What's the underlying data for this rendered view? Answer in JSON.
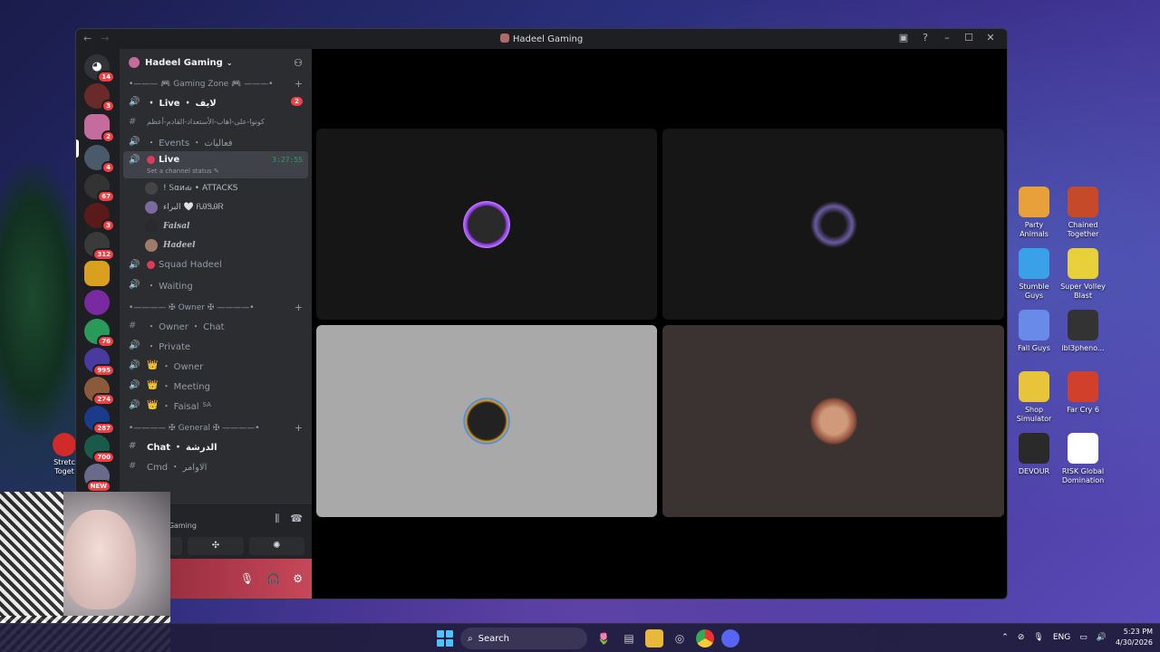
{
  "window": {
    "title": "Hadeel Gaming",
    "nav_back": "←",
    "nav_forward": "→"
  },
  "rail": {
    "badges": [
      "14",
      "3",
      "2",
      "4",
      "67",
      "3",
      "312",
      "76",
      "995",
      "274",
      "287",
      "700",
      "NEW"
    ]
  },
  "sidebar": {
    "server_name": "Hadeel Gaming",
    "category_gaming": "Gaming Zone",
    "category_owner": "Owner",
    "category_general": "General",
    "channels": {
      "live_text": "・ Live ・ لايف",
      "live_count": "2",
      "rules_text": "كونوا-على-اهاب-الأستعداد-القادم-أعظم",
      "events": "・ Events ・ فعاليات",
      "live_voice": "Live",
      "live_timer": "3:27:55",
      "live_status": "Set a channel status",
      "squad": "Squad Hadeel",
      "waiting": "・ Waiting",
      "owner_chat": "・ Owner ・ Chat",
      "private": "・ Private",
      "owner_voice": "・ Owner",
      "meeting": "・ Meeting",
      "faisal_voice": "・ Faisal",
      "faisal_suffix": "SA",
      "chat": "Chat ・ الدرشة",
      "cmd": "Cmd ・ الاوامر"
    },
    "voice_users": [
      "! Ꮪαиԃ • ATTACKS",
      "البراء 🤍 ᏲᎯᏕᎯᏒ",
      "Faisal",
      "Hadeel"
    ]
  },
  "voice_panel": {
    "status": "ed",
    "server": "el Gaming"
  },
  "desktop_icons": [
    {
      "label": "Party Animals",
      "color": "#e8a13a"
    },
    {
      "label": "Chained Together",
      "color": "#c44a2a"
    },
    {
      "label": "Stumble Guys",
      "color": "#3aa0e8"
    },
    {
      "label": "Super Volley Blast",
      "color": "#e8d03a"
    },
    {
      "label": "Fall Guys",
      "color": "#6a8ae8"
    },
    {
      "label": "ibl3pheno...",
      "color": "#333333"
    },
    {
      "label": "Shop Simulator",
      "color": "#e8c43a"
    },
    {
      "label": "Far Cry 6",
      "color": "#d0402a"
    },
    {
      "label": "DEVOUR",
      "color": "#2a2a2a"
    },
    {
      "label": "RISK Global Domination",
      "color": "#ffffff"
    }
  ],
  "desktop_left_label": "Stretc Toget",
  "taskbar": {
    "search_placeholder": "Search",
    "language": "ENG",
    "time": "5:23 PM",
    "date": "4/30/2026"
  },
  "colors": {
    "accent": "#5865f2",
    "danger": "#f23f43",
    "online": "#23a55a"
  }
}
